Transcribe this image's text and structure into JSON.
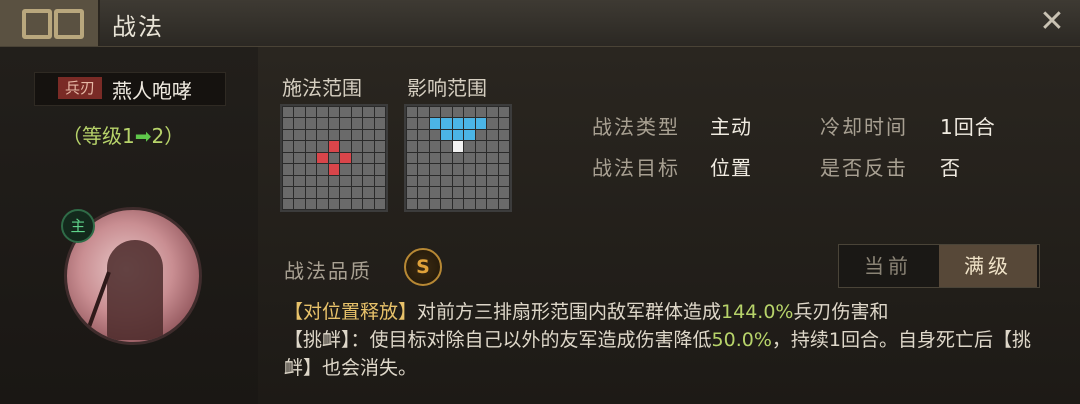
{
  "window": {
    "title": "战法"
  },
  "general": {
    "tag": "兵刃",
    "name": "燕人咆哮",
    "level_prefix": "（等级1",
    "level_arrow": "➡",
    "level_suffix": "2）",
    "badge": "主"
  },
  "ranges": {
    "cast_label": "施法范围",
    "effect_label": "影响范围",
    "cast_cells": {
      "red": [
        [
          3,
          4
        ],
        [
          4,
          3
        ],
        [
          4,
          5
        ],
        [
          5,
          4
        ]
      ]
    },
    "effect_cells": {
      "blue": [
        [
          1,
          2
        ],
        [
          1,
          3
        ],
        [
          1,
          4
        ],
        [
          1,
          5
        ],
        [
          1,
          6
        ],
        [
          2,
          3
        ],
        [
          2,
          4
        ],
        [
          2,
          5
        ]
      ],
      "white": [
        [
          3,
          4
        ]
      ]
    }
  },
  "attributes": [
    {
      "label": "战法类型",
      "value": "主动"
    },
    {
      "label": "冷却时间",
      "value": "1回合"
    },
    {
      "label": "战法目标",
      "value": "位置"
    },
    {
      "label": "是否反击",
      "value": "否"
    }
  ],
  "quality": {
    "label": "战法品质",
    "grade": "S"
  },
  "toggle": {
    "current": "当前",
    "max": "满级"
  },
  "description": {
    "p1_hl": "【对位置释放】",
    "p1_text": "对前方三排扇形范围内敌军群体造成",
    "p1_num": "144.0%",
    "p1_tail": "兵刃伤害和",
    "p2_hl": "【挑衅】",
    "p2_text": "：使目标对除自己以外的友军造成伤害降低",
    "p2_num": "50.0%",
    "p2_tail": "，持续1回合。自身死亡后【挑衅】也会消失。"
  },
  "icons": {
    "close": "close-icon",
    "ornament": "title-ornament-icon"
  }
}
